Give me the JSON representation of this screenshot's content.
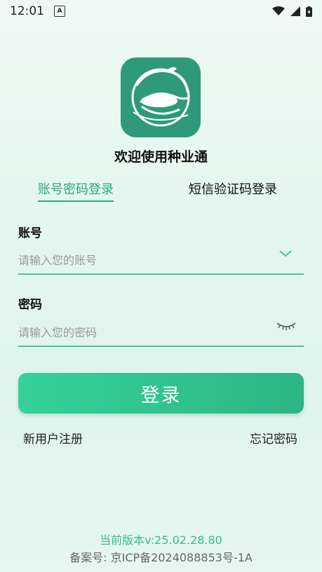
{
  "status_bar": {
    "time": "12:01",
    "notif_glyph": "A"
  },
  "app": {
    "welcome": "欢迎使用种业通"
  },
  "tabs": [
    {
      "label": "账号密码登录",
      "active": true
    },
    {
      "label": "短信验证码登录",
      "active": false
    }
  ],
  "form": {
    "account_label": "账号",
    "account_placeholder": "请输入您的账号",
    "password_label": "密码",
    "password_placeholder": "请输入您的密码"
  },
  "login_button": "登录",
  "links": {
    "register": "新用户注册",
    "forgot": "忘记密码"
  },
  "footer": {
    "version": "当前版本v:25.02.28.80",
    "icp": "备案号: 京ICP备2024088853号-1A"
  },
  "colors": {
    "accent": "#2fa77c",
    "button": "#33c793",
    "logo_bg": "#2e9a7a"
  },
  "icons": [
    "wifi-icon",
    "signal-icon",
    "battery-icon",
    "chevron-down-icon",
    "eye-closed-icon",
    "app-logo"
  ]
}
